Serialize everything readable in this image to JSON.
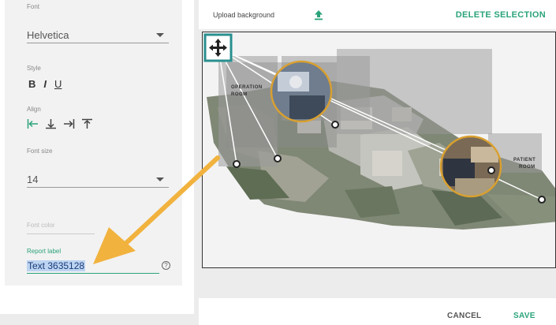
{
  "panel": {
    "font_label": "Font",
    "font_value": "Helvetica",
    "style_label": "Style",
    "style_bold": "B",
    "style_italic": "I",
    "style_underline": "U",
    "align_label": "Align",
    "font_size_label": "Font size",
    "font_size_value": "14",
    "font_color_label": "Font color",
    "report_label_label": "Report label",
    "report_label_value": "Text 3635128",
    "help_glyph": "?"
  },
  "toolbar": {
    "upload_label": "Upload background",
    "delete_label": "DELETE SELECTION"
  },
  "canvas": {
    "operation_room_label_1": "OPERATION",
    "operation_room_label_2": "ROOM",
    "patient_room_label_1": "PATIENT",
    "patient_room_label_2": "ROOM"
  },
  "footer": {
    "cancel_label": "CANCEL",
    "save_label": "SAVE"
  },
  "colors": {
    "accent": "#2aa37a",
    "callout_ring": "#d9a030",
    "annotation_arrow": "#f1b23e",
    "move_handle": "#2a8f8f"
  }
}
